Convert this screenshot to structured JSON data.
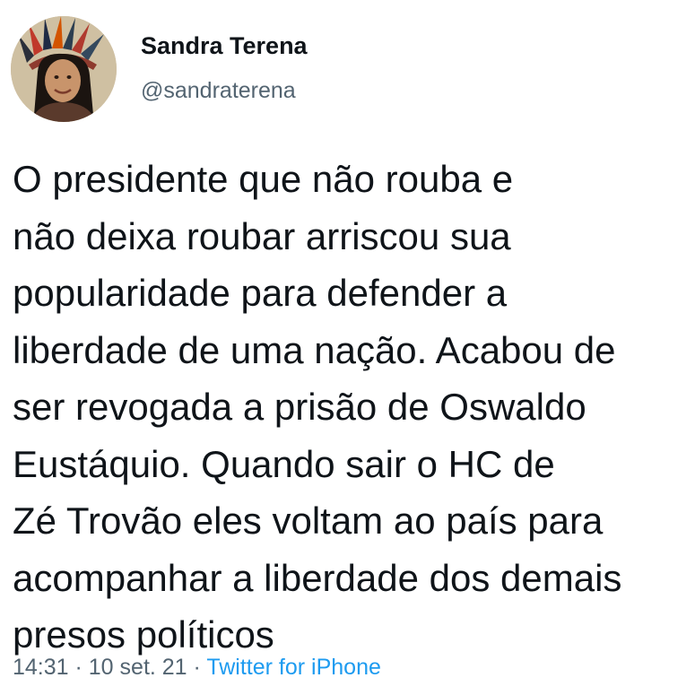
{
  "author": {
    "display_name": "Sandra Terena",
    "handle": "@sandraterena",
    "avatar_icon": "user-avatar-photo"
  },
  "tweet": {
    "lines": [
      "O presidente que não rouba e",
      "não deixa roubar arriscou sua",
      "popularidade para defender a",
      "liberdade de uma nação. Acabou de",
      "ser revogada a prisão de Oswaldo",
      "Eustáquio. Quando sair o HC de",
      "Zé Trovão eles voltam ao país para",
      "acompanhar a liberdade dos demais",
      "presos políticos"
    ]
  },
  "meta": {
    "time": "14:31",
    "separator": " · ",
    "date": "10 set. 21",
    "source": "Twitter for iPhone"
  },
  "colors": {
    "text": "#0f1419",
    "secondary": "#536471",
    "link": "#1d9bf0"
  }
}
